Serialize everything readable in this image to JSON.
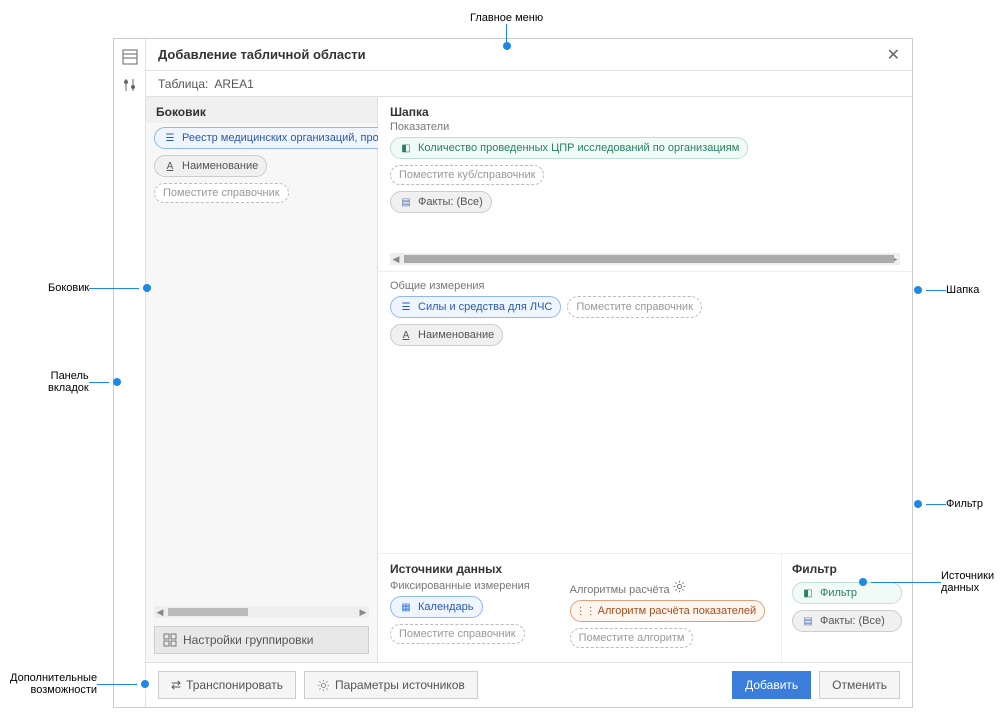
{
  "dialog": {
    "title": "Добавление табличной области",
    "tableLabel": "Таблица:",
    "tableValue": "AREA1"
  },
  "side": {
    "title": "Боковик",
    "ref": "Реестр медицинских организаций, провод",
    "attr": "Наименование",
    "placeholder": "Поместите справочник",
    "groupBtn": "Настройки группировки"
  },
  "shapka": {
    "title": "Шапка",
    "sub": "Показатели",
    "cube": "Количество проведенных ЦПР исследований по организациям",
    "cubePlaceholder": "Поместите куб/справочник",
    "facts": "Факты: (Все)"
  },
  "measures": {
    "title": "Общие измерения",
    "ref": "Силы и средства для ЛЧС",
    "placeholder": "Поместите справочник",
    "attr": "Наименование"
  },
  "sources": {
    "title": "Источники данных",
    "fixed": "Фиксированные измерения",
    "calendar": "Календарь",
    "refPlaceholder": "Поместите справочник",
    "algoTitle": "Алгоритмы расчёта",
    "algo": "Алгоритм расчёта показателей",
    "algoPlaceholder": "Поместите алгоритм"
  },
  "filter": {
    "title": "Фильтр",
    "chip": "Фильтр",
    "facts": "Факты: (Все)"
  },
  "footer": {
    "transpose": "Транспонировать",
    "params": "Параметры источников",
    "add": "Добавить",
    "cancel": "Отменить"
  },
  "callouts": {
    "mainmenu": "Главное меню",
    "bokovik": "Боковик",
    "tabs": "Панель\nвкладок",
    "shapka": "Шапка",
    "filter": "Фильтр",
    "sources": "Источники\nданных",
    "extra": "Дополнительные\nвозможности"
  }
}
